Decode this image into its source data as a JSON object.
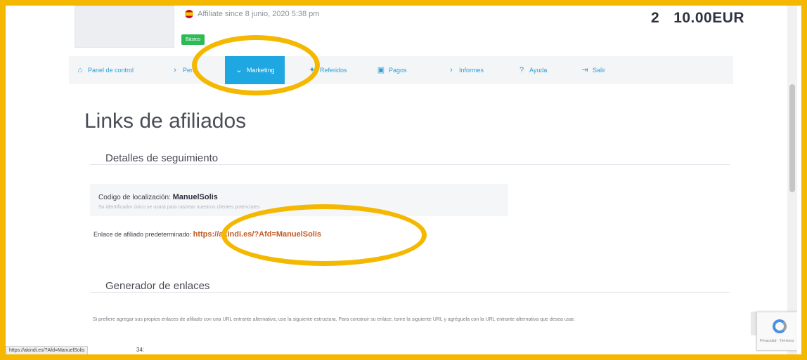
{
  "header": {
    "affiliate_since": "Affiliate since 8 junio, 2020 5:38 pm",
    "badge": "Básico",
    "stats_count": "2",
    "stats_amount": "10.00EUR"
  },
  "nav": {
    "items": [
      {
        "label": "Panel de control",
        "icon": "home-icon"
      },
      {
        "label": "Perfil",
        "icon": "chevron-right-icon"
      },
      {
        "label": "Marketing",
        "icon": "chevron-down-icon"
      },
      {
        "label": "Referidos",
        "icon": "twitter-bird-icon"
      },
      {
        "label": "Pagos",
        "icon": "money-icon"
      },
      {
        "label": "Informes",
        "icon": "chevron-right-icon"
      },
      {
        "label": "Ayuda",
        "icon": "question-icon"
      },
      {
        "label": "Salir",
        "icon": "logout-icon"
      }
    ]
  },
  "page": {
    "title": "Links de afiliados",
    "tracking": {
      "heading": "Detalles de seguimiento",
      "code_label": "Codigo de localización:",
      "code_value": "ManuelSolis",
      "code_help": "Su identificador único se usará para rastrear nuestros clientes potenciales",
      "link_label": "Enlace de afiliado predeterminado:",
      "link_value": "https://akindi.es/?Afd=ManuelSolis"
    },
    "generator": {
      "heading": "Generador de enlaces",
      "description": "Si prefiere agregar sus propios enlaces de afiliado con una URL entrante alternativa, use la siguiente estructura. Para construir su enlace, tome la siguiente URL y agréguela con la URL entrante alternativa que desea usar."
    }
  },
  "statusbar": {
    "url": "https://akindi.es/?Afd=ManuelSolis",
    "tail": "34:"
  },
  "colors": {
    "highlight": "#F5B800",
    "nav_active": "#1EA7E1",
    "link": "#C25A23"
  }
}
